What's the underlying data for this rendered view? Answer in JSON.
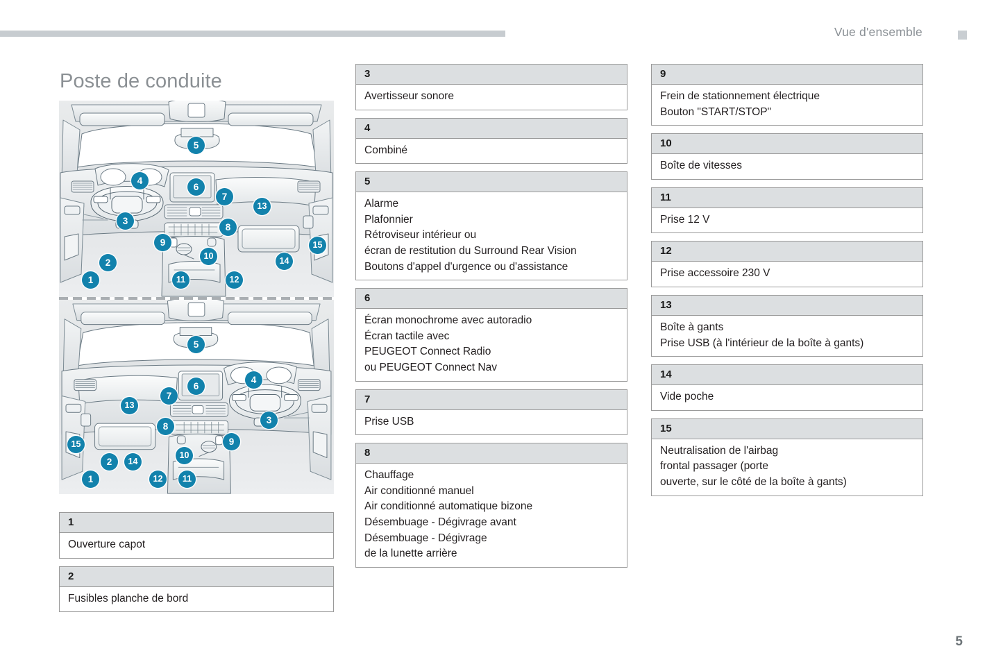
{
  "header": {
    "section_title": "Vue d'ensemble",
    "marker_icon": "square-marker-icon"
  },
  "page": {
    "title": "Poste de conduite",
    "number": "5"
  },
  "illustrations": [
    {
      "name": "dashboard-left-hand-drive",
      "callouts": [
        "5",
        "4",
        "6",
        "7",
        "13",
        "3",
        "8",
        "9",
        "15",
        "2",
        "10",
        "14",
        "1",
        "11",
        "12"
      ]
    },
    {
      "name": "dashboard-right-hand-drive",
      "callouts": [
        "5",
        "6",
        "13",
        "7",
        "4",
        "8",
        "3",
        "15",
        "9",
        "2",
        "14",
        "10",
        "1",
        "12",
        "11"
      ]
    }
  ],
  "columns": {
    "left": [
      {
        "number": "1",
        "lines": [
          "Ouverture capot"
        ]
      },
      {
        "number": "2",
        "lines": [
          "Fusibles planche de bord"
        ]
      }
    ],
    "middle": [
      {
        "number": "3",
        "lines": [
          "Avertisseur sonore"
        ]
      },
      {
        "number": "4",
        "lines": [
          "Combiné"
        ]
      },
      {
        "number": "5",
        "lines": [
          "Alarme",
          "Plafonnier",
          "Rétroviseur intérieur ou",
          "écran de restitution du Surround Rear Vision",
          "Boutons d'appel d'urgence ou d'assistance"
        ]
      },
      {
        "number": "6",
        "lines": [
          "Écran monochrome avec autoradio",
          "Écran tactile avec",
          "PEUGEOT Connect Radio",
          "ou PEUGEOT Connect Nav"
        ]
      },
      {
        "number": "7",
        "lines": [
          "Prise USB"
        ]
      },
      {
        "number": "8",
        "lines": [
          "Chauffage",
          "Air conditionné manuel",
          "Air conditionné automatique bizone",
          "Désembuage - Dégivrage avant",
          "Désembuage - Dégivrage",
          "de la lunette arrière"
        ]
      }
    ],
    "right": [
      {
        "number": "9",
        "lines": [
          "Frein de stationnement électrique",
          "Bouton \"START/STOP\""
        ]
      },
      {
        "number": "10",
        "lines": [
          "Boîte de vitesses"
        ]
      },
      {
        "number": "11",
        "lines": [
          "Prise 12 V"
        ]
      },
      {
        "number": "12",
        "lines": [
          "Prise accessoire 230 V"
        ]
      },
      {
        "number": "13",
        "lines": [
          "Boîte à gants",
          "Prise USB (à l'intérieur de la boîte à gants)"
        ]
      },
      {
        "number": "14",
        "lines": [
          "Vide poche"
        ]
      },
      {
        "number": "15",
        "lines": [
          "Neutralisation de l'airbag",
          "frontal passager (porte",
          "ouverte, sur le côté de la boîte à gants)"
        ]
      }
    ]
  },
  "colors": {
    "badge": "#1282ac",
    "header_rule": "#c7ccd0",
    "block_header_bg": "#dcdfe1",
    "block_border": "#9a9a9a",
    "title_text": "#8b9094"
  }
}
